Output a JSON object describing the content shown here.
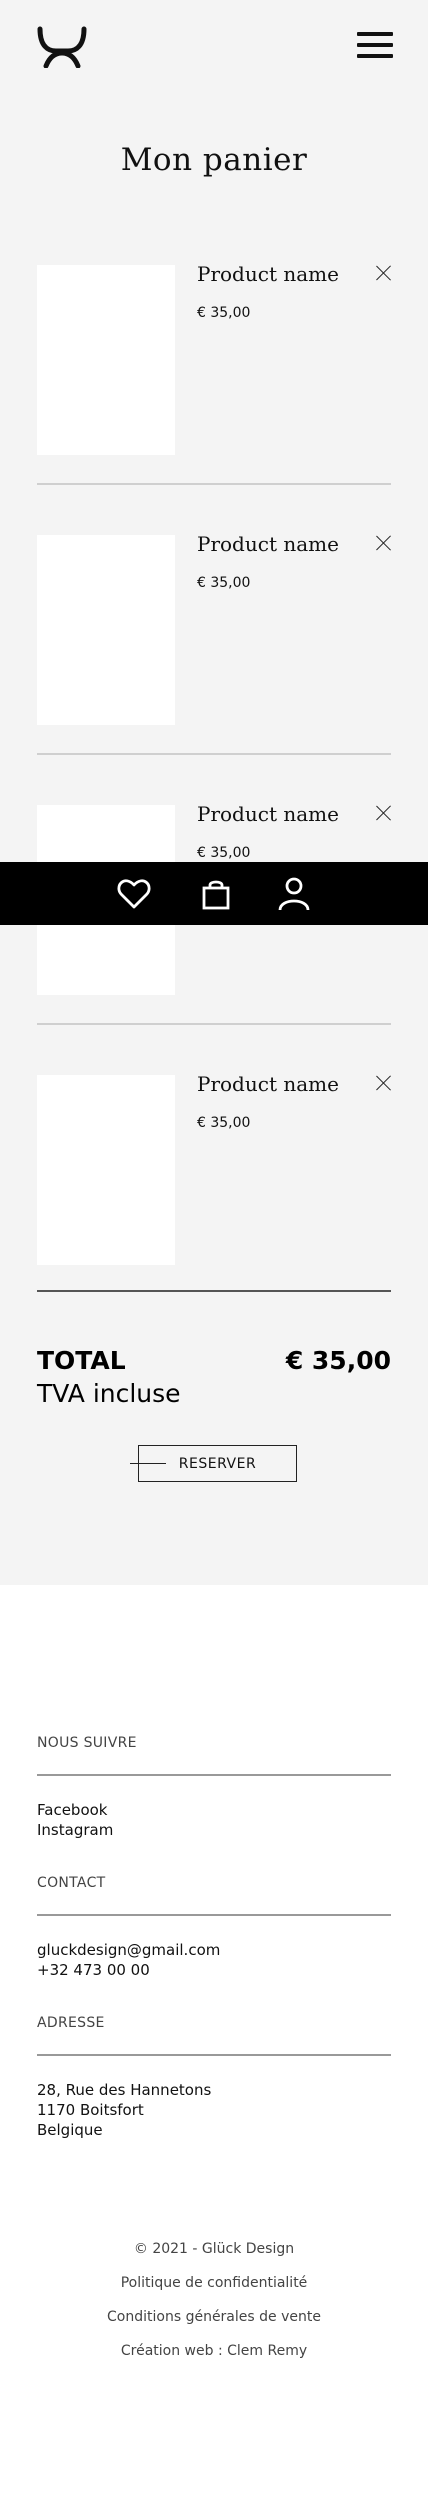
{
  "header": {
    "logo_icon": "brand-logo-icon",
    "menu_icon": "hamburger-menu-icon"
  },
  "page": {
    "title": "Mon panier"
  },
  "cart": {
    "items": [
      {
        "name": "Product name",
        "price": "€ 35,00"
      },
      {
        "name": "Product name",
        "price": "€ 35,00"
      },
      {
        "name": "Product name",
        "price": "€ 35,00"
      },
      {
        "name": "Product name",
        "price": "€ 35,00"
      }
    ],
    "remove_icon": "close-icon",
    "total_label": "TOTAL",
    "total_value": "€ 35,00",
    "vat_label": "TVA incluse",
    "reserve_label": "RESERVER"
  },
  "bottom_nav": {
    "icons": [
      "heart-icon",
      "shopping-bag-icon",
      "user-icon"
    ]
  },
  "footer": {
    "follow": {
      "heading": "NOUS SUIVRE",
      "links": [
        "Facebook",
        "Instagram"
      ]
    },
    "contact": {
      "heading": "CONTACT",
      "email": "gluckdesign@gmail.com",
      "phone": "+32 473 00 00"
    },
    "address": {
      "heading": "ADRESSE",
      "line1": "28, Rue des Hannetons",
      "line2": "1170 Boitsfort",
      "line3": "Belgique"
    },
    "copyright": "© 2021 - Glück Design",
    "privacy": "Politique de confidentialité",
    "terms": "Conditions générales de vente",
    "credit": "Création web : Clem Remy"
  },
  "colors": {
    "page_background": "#f4f4f4",
    "footer_background": "#ffffff",
    "bottom_bar": "#000000",
    "text": "#111111"
  }
}
